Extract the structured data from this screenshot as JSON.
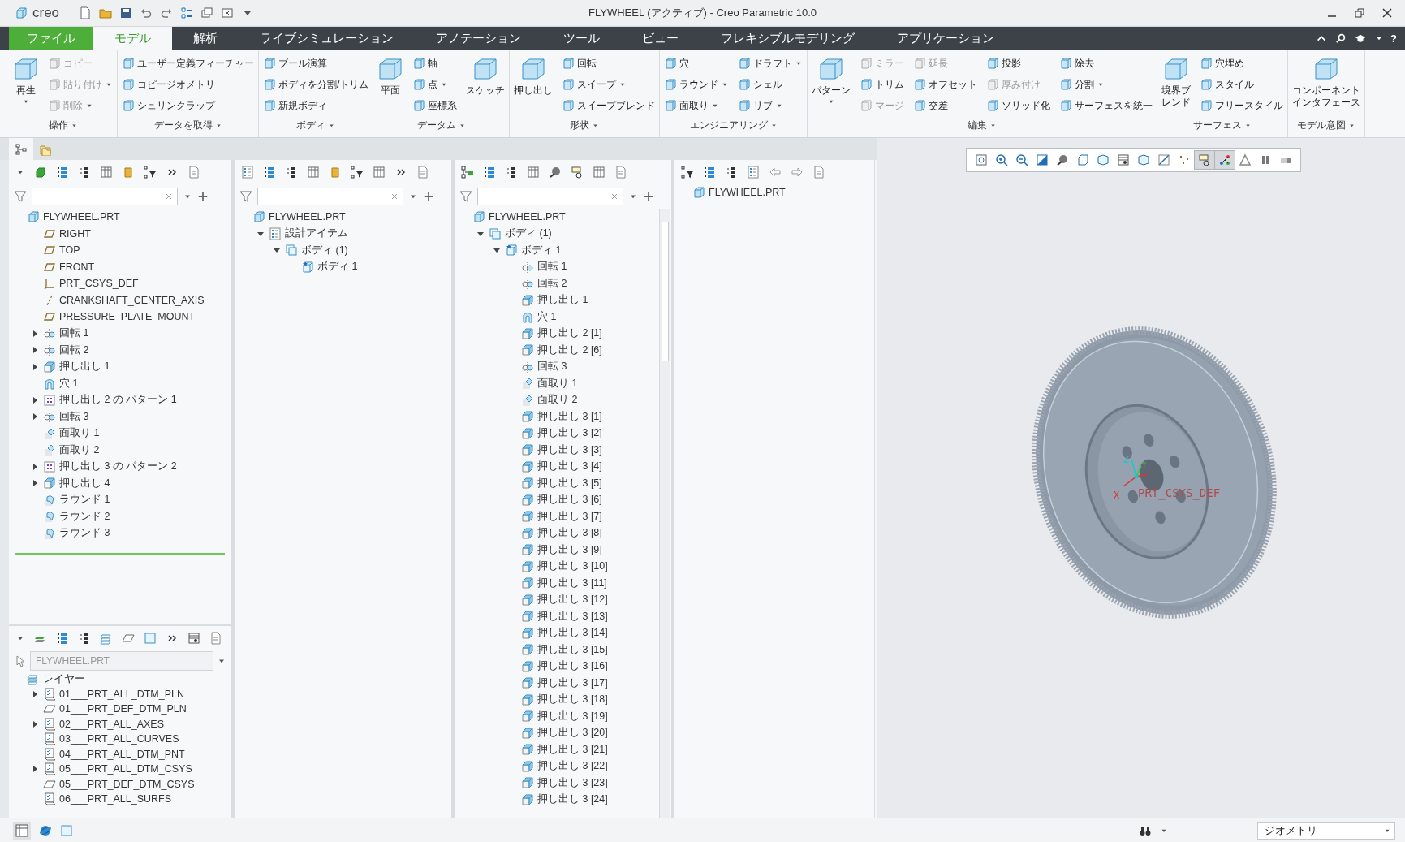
{
  "window": {
    "logo": "creo",
    "title": "FLYWHEEL (アクティブ) - Creo Parametric 10.0"
  },
  "ribbon_tabs": [
    {
      "label": "ファイル",
      "kind": "file",
      "selected": false
    },
    {
      "label": "モデル",
      "kind": "tab",
      "selected": true
    },
    {
      "label": "解析",
      "kind": "tab",
      "selected": false
    },
    {
      "label": "ライブシミュレーション",
      "kind": "tab",
      "selected": false
    },
    {
      "label": "アノテーション",
      "kind": "tab",
      "selected": false
    },
    {
      "label": "ツール",
      "kind": "tab",
      "selected": false
    },
    {
      "label": "ビュー",
      "kind": "tab",
      "selected": false
    },
    {
      "label": "フレキシブルモデリング",
      "kind": "tab",
      "selected": false
    },
    {
      "label": "アプリケーション",
      "kind": "tab",
      "selected": false
    }
  ],
  "help_button": "?",
  "ribbon_groups": [
    {
      "label": "操作",
      "columns": [
        [
          {
            "label_lines": [
              "再生"
            ],
            "kind": "large",
            "disabled": false,
            "menu": true
          }
        ],
        [
          {
            "label": "コピー",
            "kind": "small",
            "disabled": true,
            "menu": false
          },
          {
            "label": "貼り付け",
            "kind": "small",
            "disabled": true,
            "menu": true
          },
          {
            "label": "削除",
            "kind": "small",
            "disabled": true,
            "menu": true
          }
        ]
      ]
    },
    {
      "label": "データを取得",
      "columns": [
        [
          {
            "label": "ユーザー定義フィーチャー",
            "kind": "small",
            "disabled": false,
            "menu": false
          },
          {
            "label": "コピージオメトリ",
            "kind": "small",
            "disabled": false,
            "menu": false
          },
          {
            "label": "シュリンクラップ",
            "kind": "small",
            "disabled": false,
            "menu": false
          }
        ]
      ]
    },
    {
      "label": "ボディ",
      "columns": [
        [
          {
            "label": "ブール演算",
            "kind": "small",
            "disabled": false,
            "menu": false
          },
          {
            "label": "ボディを分割/トリム",
            "kind": "small",
            "disabled": false,
            "menu": false
          },
          {
            "label": "新規ボディ",
            "kind": "small",
            "disabled": false,
            "menu": false
          }
        ]
      ]
    },
    {
      "label": "データム",
      "columns": [
        [
          {
            "label_lines": [
              "平面"
            ],
            "kind": "large",
            "disabled": false,
            "menu": false
          }
        ],
        [
          {
            "label": "軸",
            "kind": "small",
            "disabled": false,
            "menu": false
          },
          {
            "label": "点",
            "kind": "small",
            "disabled": false,
            "menu": true
          },
          {
            "label": "座標系",
            "kind": "small",
            "disabled": false,
            "menu": false
          }
        ],
        [
          {
            "label_lines": [
              "スケッチ"
            ],
            "kind": "large",
            "disabled": false,
            "menu": false
          }
        ]
      ]
    },
    {
      "label": "形状",
      "columns": [
        [
          {
            "label_lines": [
              "押し出し"
            ],
            "kind": "large",
            "disabled": false,
            "menu": false
          }
        ],
        [
          {
            "label": "回転",
            "kind": "small",
            "disabled": false,
            "menu": false
          },
          {
            "label": "スイープ",
            "kind": "small",
            "disabled": false,
            "menu": true
          },
          {
            "label": "スイープブレンド",
            "kind": "small",
            "disabled": false,
            "menu": false
          }
        ]
      ]
    },
    {
      "label": "エンジニアリング",
      "columns": [
        [
          {
            "label": "穴",
            "kind": "small",
            "disabled": false,
            "menu": false
          },
          {
            "label": "ラウンド",
            "kind": "small",
            "disabled": false,
            "menu": true
          },
          {
            "label": "面取り",
            "kind": "small",
            "disabled": false,
            "menu": true
          }
        ],
        [
          {
            "label": "ドラフト",
            "kind": "small",
            "disabled": false,
            "menu": true
          },
          {
            "label": "シェル",
            "kind": "small",
            "disabled": false,
            "menu": false
          },
          {
            "label": "リブ",
            "kind": "small",
            "disabled": false,
            "menu": true
          }
        ]
      ]
    },
    {
      "label": "編集",
      "columns": [
        [
          {
            "label_lines": [
              "パターン"
            ],
            "kind": "large",
            "disabled": false,
            "menu": true
          }
        ],
        [
          {
            "label": "ミラー",
            "kind": "small",
            "disabled": true,
            "menu": false
          },
          {
            "label": "トリム",
            "kind": "small",
            "disabled": false,
            "menu": false
          },
          {
            "label": "マージ",
            "kind": "small",
            "disabled": true,
            "menu": false
          }
        ],
        [
          {
            "label": "延長",
            "kind": "small",
            "disabled": true,
            "menu": false
          },
          {
            "label": "オフセット",
            "kind": "small",
            "disabled": false,
            "menu": false
          },
          {
            "label": "交差",
            "kind": "small",
            "disabled": false,
            "menu": false
          }
        ],
        [
          {
            "label": "投影",
            "kind": "small",
            "disabled": false,
            "menu": false
          },
          {
            "label": "厚み付け",
            "kind": "small",
            "disabled": true,
            "menu": false
          },
          {
            "label": "ソリッド化",
            "kind": "small",
            "disabled": false,
            "menu": false
          }
        ],
        [
          {
            "label": "除去",
            "kind": "small",
            "disabled": false,
            "menu": false
          },
          {
            "label": "分割",
            "kind": "small",
            "disabled": false,
            "menu": true
          },
          {
            "label": "サーフェスを統一",
            "kind": "small",
            "disabled": false,
            "menu": false
          }
        ]
      ]
    },
    {
      "label": "サーフェス",
      "columns": [
        [
          {
            "label_lines": [
              "境界ブ",
              "レンド"
            ],
            "kind": "large",
            "disabled": false,
            "menu": false
          }
        ],
        [
          {
            "label": "穴埋め",
            "kind": "small",
            "disabled": false,
            "menu": false
          },
          {
            "label": "スタイル",
            "kind": "small",
            "disabled": false,
            "menu": false
          },
          {
            "label": "フリースタイル",
            "kind": "small",
            "disabled": false,
            "menu": false
          }
        ]
      ]
    },
    {
      "label": "モデル意図",
      "columns": [
        [
          {
            "label_lines": [
              "コンポーネント",
              "インタフェース"
            ],
            "kind": "large",
            "disabled": false,
            "menu": false
          }
        ]
      ]
    }
  ],
  "navigator_tabs": [
    {
      "selected": true
    },
    {
      "selected": false
    }
  ],
  "model_tree": {
    "root": {
      "label": "FLYWHEEL.PRT",
      "kind": "part",
      "children": [
        {
          "label": "RIGHT",
          "kind": "plane"
        },
        {
          "label": "TOP",
          "kind": "plane"
        },
        {
          "label": "FRONT",
          "kind": "plane"
        },
        {
          "label": "PRT_CSYS_DEF",
          "kind": "csys"
        },
        {
          "label": "CRANKSHAFT_CENTER_AXIS",
          "kind": "axis"
        },
        {
          "label": "PRESSURE_PLATE_MOUNT",
          "kind": "plane"
        },
        {
          "label": "回転 1",
          "kind": "revolve",
          "expanded": false
        },
        {
          "label": "回転 2",
          "kind": "revolve",
          "expanded": false
        },
        {
          "label": "押し出し 1",
          "kind": "extrude",
          "expanded": false
        },
        {
          "label": "穴 1",
          "kind": "hole"
        },
        {
          "label": "押し出し 2 の パターン 1",
          "kind": "pattern",
          "expanded": false
        },
        {
          "label": "回転 3",
          "kind": "revolve",
          "expanded": false
        },
        {
          "label": "面取り 1",
          "kind": "chamfer"
        },
        {
          "label": "面取り 2",
          "kind": "chamfer"
        },
        {
          "label": "押し出し 3 の パターン 2",
          "kind": "pattern",
          "expanded": false
        },
        {
          "label": "押し出し 4",
          "kind": "extrude",
          "expanded": false
        },
        {
          "label": "ラウンド 1",
          "kind": "round"
        },
        {
          "label": "ラウンド 2",
          "kind": "round"
        },
        {
          "label": "ラウンド 3",
          "kind": "round"
        }
      ]
    }
  },
  "layer_tree": {
    "model": "FLYWHEEL.PRT",
    "root": {
      "label": "レイヤー",
      "kind": "layers",
      "children": [
        {
          "label": "01___PRT_ALL_DTM_PLN",
          "kind": "layer",
          "expanded": false
        },
        {
          "label": "01___PRT_DEF_DTM_PLN",
          "kind": "default_layer"
        },
        {
          "label": "02___PRT_ALL_AXES",
          "kind": "layer",
          "expanded": false
        },
        {
          "label": "03___PRT_ALL_CURVES",
          "kind": "layer"
        },
        {
          "label": "04___PRT_ALL_DTM_PNT",
          "kind": "layer"
        },
        {
          "label": "05___PRT_ALL_DTM_CSYS",
          "kind": "layer",
          "expanded": false
        },
        {
          "label": "05___PRT_DEF_DTM_CSYS",
          "kind": "default_layer"
        },
        {
          "label": "06___PRT_ALL_SURFS",
          "kind": "layer"
        }
      ]
    }
  },
  "design_tree": {
    "root": {
      "label": "FLYWHEEL.PRT",
      "kind": "part",
      "children": [
        {
          "label": "設計アイテム",
          "kind": "design",
          "expanded": true,
          "children": [
            {
              "label": "ボディ (1)",
              "kind": "bodies",
              "expanded": true,
              "children": [
                {
                  "label": "ボディ 1",
                  "kind": "body"
                }
              ]
            }
          ]
        }
      ]
    }
  },
  "body_tree": {
    "root": {
      "label": "FLYWHEEL.PRT",
      "kind": "part",
      "children": [
        {
          "label": "ボディ (1)",
          "kind": "bodies",
          "expanded": true,
          "children": [
            {
              "label": "ボディ 1",
              "kind": "body",
              "expanded": true,
              "children": [
                {
                  "label": "回転 1",
                  "kind": "revolve"
                },
                {
                  "label": "回転 2",
                  "kind": "revolve"
                },
                {
                  "label": "押し出し 1",
                  "kind": "extrude"
                },
                {
                  "label": "穴 1",
                  "kind": "hole"
                },
                {
                  "label": "押し出し 2 [1]",
                  "kind": "extrude"
                },
                {
                  "label": "押し出し 2 [6]",
                  "kind": "extrude"
                },
                {
                  "label": "回転 3",
                  "kind": "revolve"
                },
                {
                  "label": "面取り 1",
                  "kind": "chamfer"
                },
                {
                  "label": "面取り 2",
                  "kind": "chamfer"
                },
                {
                  "label": "押し出し 3 [1]",
                  "kind": "extrude"
                },
                {
                  "label": "押し出し 3 [2]",
                  "kind": "extrude"
                },
                {
                  "label": "押し出し 3 [3]",
                  "kind": "extrude"
                },
                {
                  "label": "押し出し 3 [4]",
                  "kind": "extrude"
                },
                {
                  "label": "押し出し 3 [5]",
                  "kind": "extrude"
                },
                {
                  "label": "押し出し 3 [6]",
                  "kind": "extrude"
                },
                {
                  "label": "押し出し 3 [7]",
                  "kind": "extrude"
                },
                {
                  "label": "押し出し 3 [8]",
                  "kind": "extrude"
                },
                {
                  "label": "押し出し 3 [9]",
                  "kind": "extrude"
                },
                {
                  "label": "押し出し 3 [10]",
                  "kind": "extrude"
                },
                {
                  "label": "押し出し 3 [11]",
                  "kind": "extrude"
                },
                {
                  "label": "押し出し 3 [12]",
                  "kind": "extrude"
                },
                {
                  "label": "押し出し 3 [13]",
                  "kind": "extrude"
                },
                {
                  "label": "押し出し 3 [14]",
                  "kind": "extrude"
                },
                {
                  "label": "押し出し 3 [15]",
                  "kind": "extrude"
                },
                {
                  "label": "押し出し 3 [16]",
                  "kind": "extrude"
                },
                {
                  "label": "押し出し 3 [17]",
                  "kind": "extrude"
                },
                {
                  "label": "押し出し 3 [18]",
                  "kind": "extrude"
                },
                {
                  "label": "押し出し 3 [19]",
                  "kind": "extrude"
                },
                {
                  "label": "押し出し 3 [20]",
                  "kind": "extrude"
                },
                {
                  "label": "押し出し 3 [21]",
                  "kind": "extrude"
                },
                {
                  "label": "押し出し 3 [22]",
                  "kind": "extrude"
                },
                {
                  "label": "押し出し 3 [23]",
                  "kind": "extrude"
                },
                {
                  "label": "押し出し 3 [24]",
                  "kind": "extrude"
                }
              ]
            }
          ]
        }
      ]
    }
  },
  "panel_4_tree": {
    "root": {
      "label": "FLYWHEEL.PRT",
      "kind": "part"
    }
  },
  "viewport": {
    "toolbar": [
      {
        "pressed": false
      },
      {
        "pressed": false
      },
      {
        "pressed": false
      },
      {
        "pressed": false
      },
      {
        "pressed": false
      },
      {
        "pressed": false
      },
      {
        "pressed": false
      },
      {
        "pressed": false
      },
      {
        "pressed": false
      },
      {
        "pressed": false
      },
      {
        "pressed": false
      },
      {
        "pressed": true
      },
      {
        "pressed": true
      },
      {
        "pressed": false
      },
      {
        "pressed": false
      },
      {
        "pressed": false
      }
    ],
    "csys_label": "PRT_CSYS_DEF",
    "axis_labels": [
      "X",
      "Y",
      "Z"
    ]
  },
  "status_bar": {
    "filter": "ジオメトリ"
  }
}
